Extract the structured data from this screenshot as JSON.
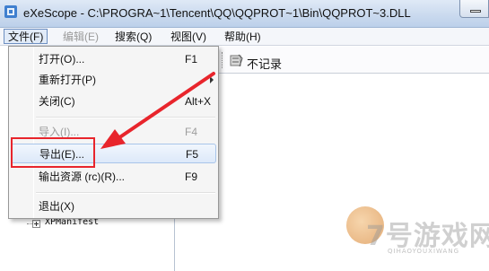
{
  "window": {
    "title": "eXeScope - C:\\PROGRA~1\\Tencent\\QQ\\QQPROT~1\\Bin\\QQPROT~3.DLL"
  },
  "menubar": {
    "items": [
      {
        "label": "文件(F)",
        "state": "active"
      },
      {
        "label": "编辑(E)",
        "state": "disabled"
      },
      {
        "label": "搜索(Q)",
        "state": "normal"
      },
      {
        "label": "视图(V)",
        "state": "normal"
      },
      {
        "label": "帮助(H)",
        "state": "normal"
      }
    ]
  },
  "toolbar": {
    "label": "不记录"
  },
  "file_menu": {
    "items": [
      {
        "label": "打开(O)...",
        "shortcut": "F1",
        "state": "normal"
      },
      {
        "label": "重新打开(P)",
        "shortcut": "",
        "state": "submenu"
      },
      {
        "label": "关闭(C)",
        "shortcut": "Alt+X",
        "state": "normal"
      },
      {
        "label": "导入(I)...",
        "shortcut": "F4",
        "state": "disabled"
      },
      {
        "label": "导出(E)...",
        "shortcut": "F5",
        "state": "hover"
      },
      {
        "label": "输出资源 (rc)(R)...",
        "shortcut": "F9",
        "state": "normal"
      },
      {
        "label": "退出(X)",
        "shortcut": "",
        "state": "normal"
      }
    ]
  },
  "tree": {
    "visible_item": "XPManifest"
  },
  "annotation": {
    "color": "#e8252c"
  },
  "watermark": {
    "brand": "7号游戏网",
    "sub": "QIHAOYOUXIWANG"
  },
  "colors": {
    "titlebar": "#c9d9ee",
    "menu_hover": "#dde9f9",
    "highlight_red": "#e8252c"
  }
}
